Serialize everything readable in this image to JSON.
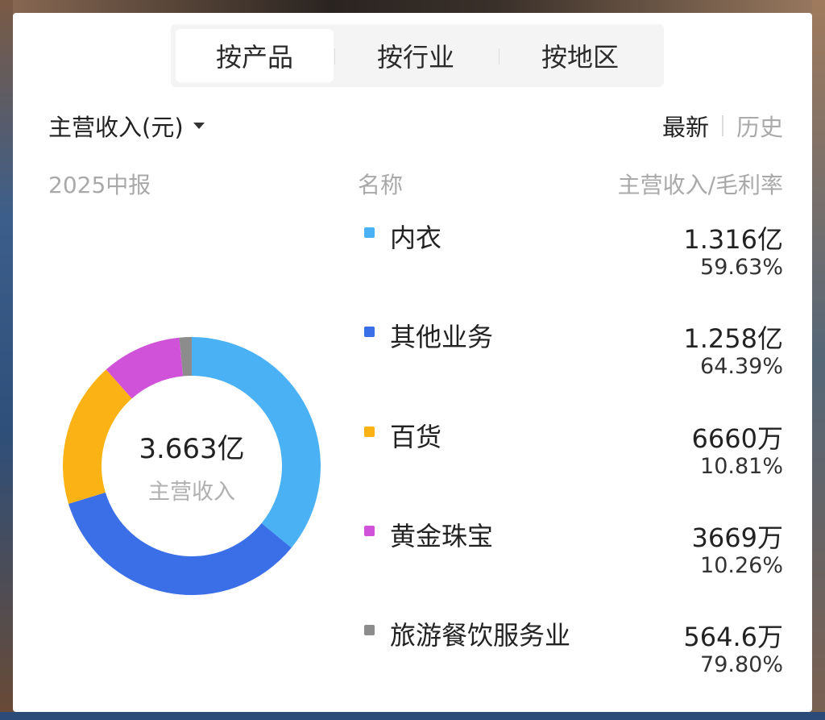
{
  "tabs": [
    {
      "label": "按产品",
      "active": true
    },
    {
      "label": "按行业",
      "active": false
    },
    {
      "label": "按地区",
      "active": false
    }
  ],
  "metric_selector": {
    "label": "主营收入(元)"
  },
  "period_toggle": {
    "latest": "最新",
    "history": "历史"
  },
  "report_period": "2025中报",
  "columns": {
    "name": "名称",
    "value": "主营收入/毛利率"
  },
  "center": {
    "value": "3.663亿",
    "label": "主营收入"
  },
  "items": [
    {
      "name": "内衣",
      "revenue": "1.316亿",
      "margin": "59.63%",
      "color": "#4ab1f5"
    },
    {
      "name": "其他业务",
      "revenue": "1.258亿",
      "margin": "64.39%",
      "color": "#3a6fe8"
    },
    {
      "name": "百货",
      "revenue": "6660万",
      "margin": "10.81%",
      "color": "#fbb214"
    },
    {
      "name": "黄金珠宝",
      "revenue": "3669万",
      "margin": "10.26%",
      "color": "#cf52d8"
    },
    {
      "name": "旅游餐饮服务业",
      "revenue": "564.6万",
      "margin": "79.80%",
      "color": "#8c8c8c"
    }
  ],
  "chart_data": {
    "type": "pie",
    "categories": [
      "内衣",
      "其他业务",
      "百货",
      "黄金珠宝",
      "旅游餐饮服务业"
    ],
    "values": [
      13160,
      12580,
      6660,
      3669,
      564.6
    ],
    "colors": [
      "#4ab1f5",
      "#3a6fe8",
      "#fbb214",
      "#cf52d8",
      "#8c8c8c"
    ],
    "donut": true
  }
}
